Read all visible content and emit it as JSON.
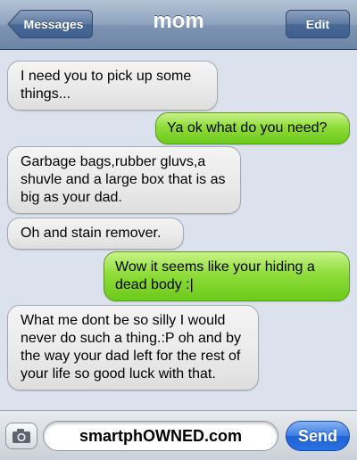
{
  "navbar": {
    "back_label": "Messages",
    "title": "mom",
    "edit_label": "Edit"
  },
  "messages": [
    {
      "direction": "incoming",
      "text": "I need you to pick up some things..."
    },
    {
      "direction": "outgoing",
      "text": "Ya ok what do you need?"
    },
    {
      "direction": "incoming",
      "text": "Garbage bags,rubber gluvs,a shuvle and a large box that is as big as your dad."
    },
    {
      "direction": "incoming",
      "text": "Oh and stain remover."
    },
    {
      "direction": "outgoing",
      "text": "Wow it seems like your hiding a dead body :|"
    },
    {
      "direction": "incoming",
      "text": "What me dont be so silly I would never do such a thing.:P oh and by the way your dad left for the rest of your life so good luck with that."
    }
  ],
  "composer": {
    "camera_icon": "camera-icon",
    "field_value": "smartphOWNED.com",
    "send_label": "Send"
  },
  "colors": {
    "incoming_bubble": "#e9e9e9",
    "outgoing_bubble": "#8fdd3a",
    "thread_background": "#dbe2ed",
    "send_button": "#2a70e0"
  }
}
